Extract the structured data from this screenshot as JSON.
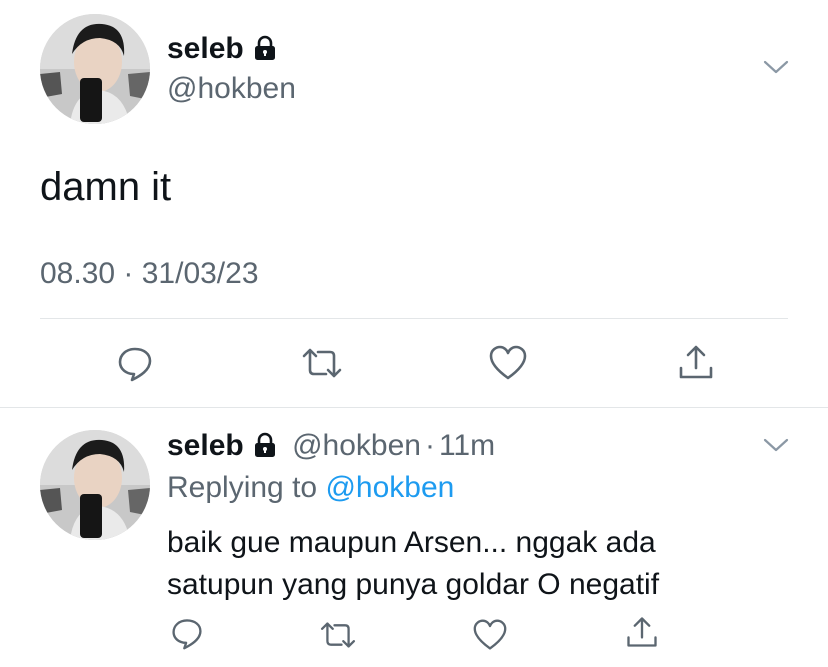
{
  "main_tweet": {
    "display_name": "seleb",
    "handle": "@hokben",
    "text": "damn it",
    "timestamp": "08.30 · 31/03/23",
    "lock_icon": "lock-icon",
    "menu_icon": "chevron-down-icon",
    "actions": [
      "reply-icon",
      "retweet-icon",
      "like-icon",
      "share-icon"
    ]
  },
  "reply_tweet": {
    "display_name": "seleb",
    "handle": "@hokben",
    "separator": "·",
    "time_ago": "11m",
    "replying_prefix": "Replying to",
    "replying_handle": "@hokben",
    "text_line1": "baik gue maupun Arsen... nggak ada",
    "text_line2": "satupun yang punya goldar O negatif",
    "menu_icon": "chevron-down-icon",
    "actions": [
      "reply-icon",
      "retweet-icon",
      "like-icon",
      "share-icon"
    ]
  },
  "colors": {
    "text": "#0f1419",
    "secondary": "#5b6670",
    "link": "#1d9bf0",
    "divider": "#e3e6e8"
  }
}
